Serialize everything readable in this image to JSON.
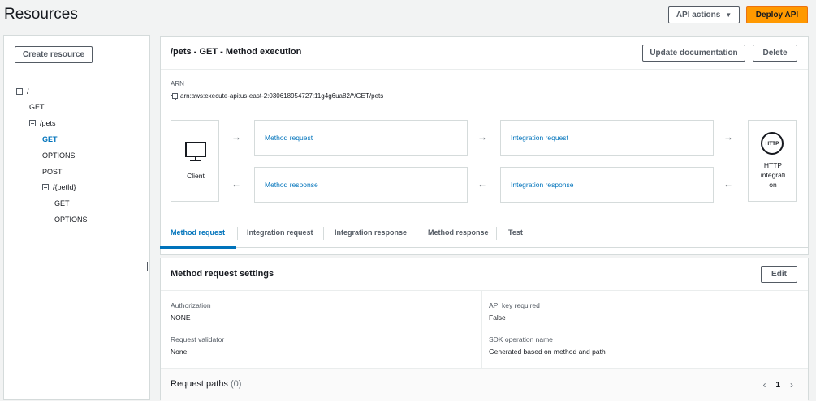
{
  "page": {
    "title": "Resources"
  },
  "top_actions": {
    "api_actions": "API actions",
    "deploy": "Deploy API"
  },
  "sidebar": {
    "create_resource": "Create resource",
    "tree": [
      {
        "label": "/",
        "collapsible": true
      },
      {
        "label": "GET"
      },
      {
        "label": "/pets",
        "collapsible": true
      },
      {
        "label": "GET",
        "selected": true
      },
      {
        "label": "OPTIONS"
      },
      {
        "label": "POST"
      },
      {
        "label": "/{petId}",
        "collapsible": true
      },
      {
        "label": "GET"
      },
      {
        "label": "OPTIONS"
      }
    ]
  },
  "execution": {
    "title": "/pets - GET - Method execution",
    "update_doc": "Update documentation",
    "delete": "Delete",
    "arn_label": "ARN",
    "arn_value": "arn:aws:execute-api:us-east-2:030618954727:11g4g6ua82/*/GET/pets",
    "client_label": "Client",
    "method_request": "Method request",
    "integration_request": "Integration request",
    "method_response": "Method response",
    "integration_response": "Integration response",
    "http_badge": "HTTP",
    "http_label_line1": "HTTP",
    "http_label_line2": "integrati",
    "http_label_line3": "on"
  },
  "tabs": [
    {
      "label": "Method request",
      "active": true
    },
    {
      "label": "Integration request"
    },
    {
      "label": "Integration response"
    },
    {
      "label": "Method response"
    },
    {
      "label": "Test"
    }
  ],
  "settings": {
    "title": "Method request settings",
    "edit": "Edit",
    "authorization_label": "Authorization",
    "authorization_value": "NONE",
    "api_key_label": "API key required",
    "api_key_value": "False",
    "validator_label": "Request validator",
    "validator_value": "None",
    "sdk_label": "SDK operation name",
    "sdk_value": "Generated based on method and path",
    "paths_title": "Request paths",
    "paths_count": "(0)",
    "page_number": "1",
    "prev_icon": "chevron-left-icon",
    "next_icon": "chevron-right-icon"
  },
  "colors": {
    "accent": "#0073bb",
    "primary_button": "#ff9900",
    "border": "#d5dbdb"
  }
}
